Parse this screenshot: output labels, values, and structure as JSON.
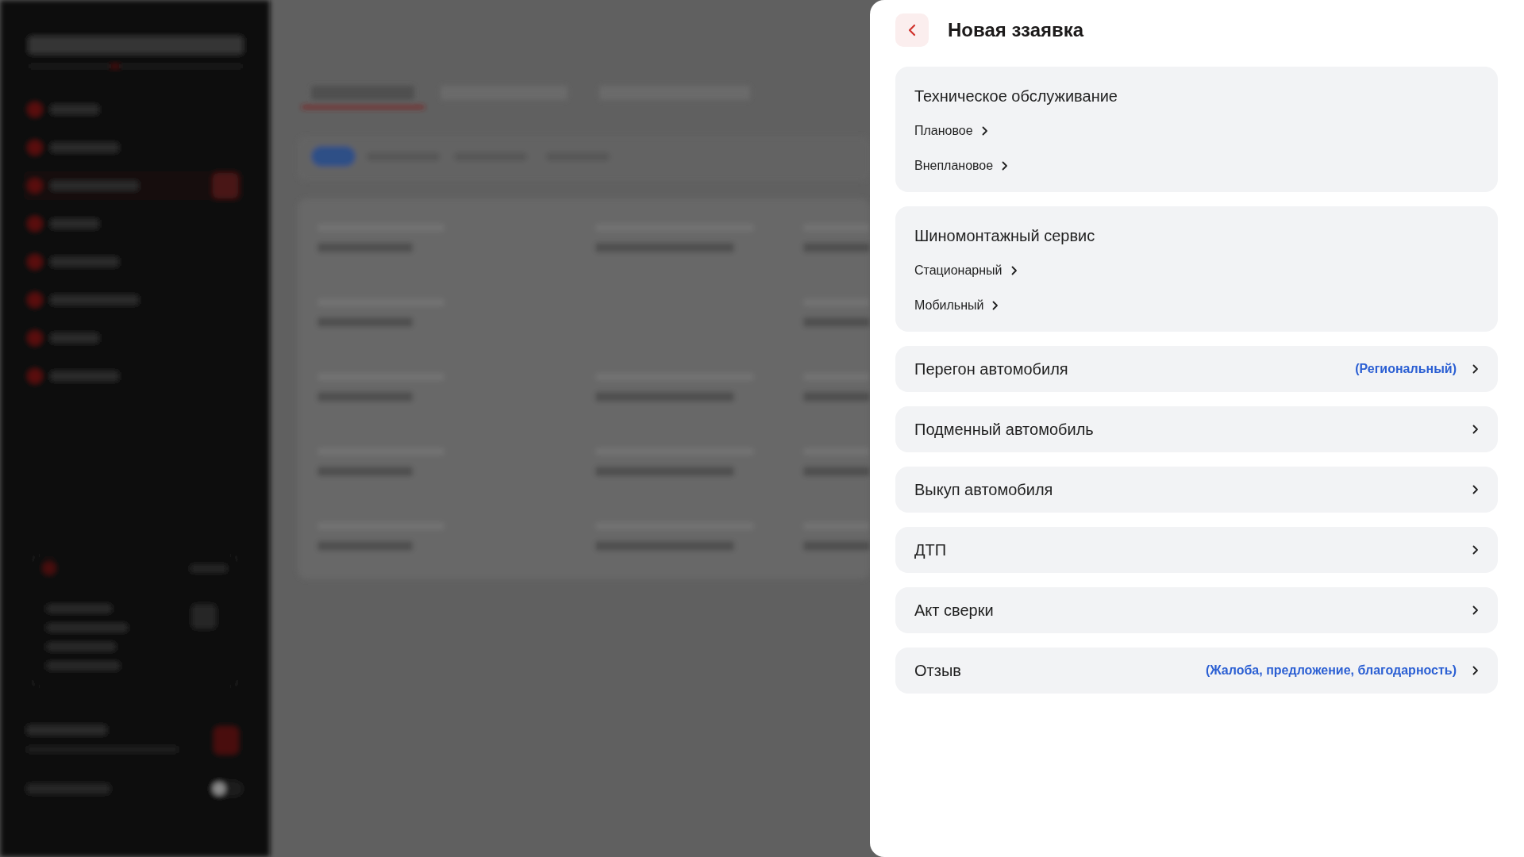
{
  "header": {
    "title": "Новая ззаявка"
  },
  "groups": [
    {
      "title": "Техническое обслуживание",
      "options": [
        "Плановое",
        "Внеплановое"
      ]
    },
    {
      "title": "Шиномонтажный сервис",
      "options": [
        "Стационарный",
        "Мобильный"
      ]
    }
  ],
  "request_types": [
    {
      "label": "Перегон автомобиля",
      "note": "(Региональный)"
    },
    {
      "label": "Подменный автомобиль"
    },
    {
      "label": "Выкуп автомобиля"
    },
    {
      "label": "ДТП"
    },
    {
      "label": "Акт сверки"
    },
    {
      "label": "Отзыв",
      "note": "(Жалоба, предложение, благодарность)"
    }
  ]
}
